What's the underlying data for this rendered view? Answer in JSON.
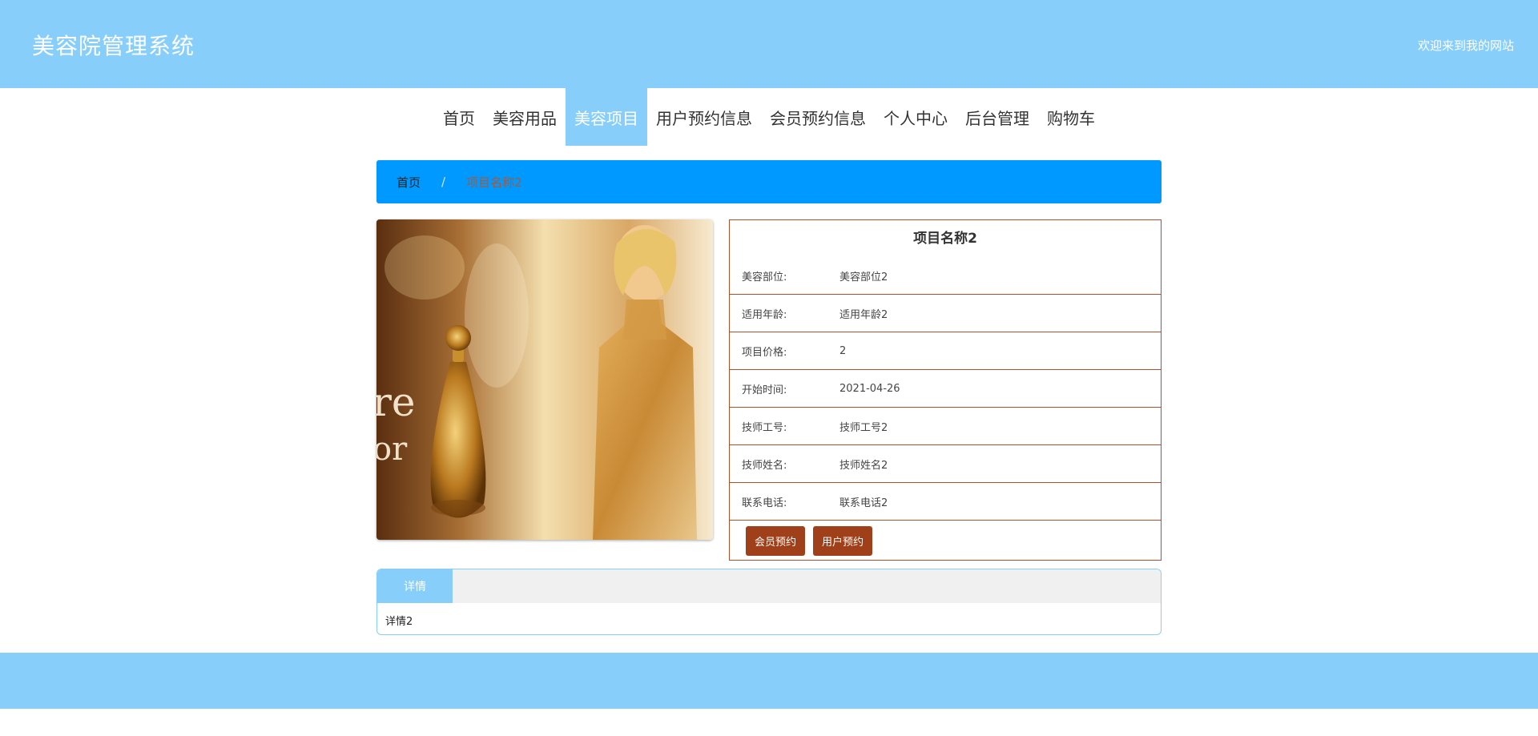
{
  "header": {
    "title": "美容院管理系统",
    "welcome": "欢迎来到我的网站"
  },
  "nav": {
    "items": [
      "首页",
      "美容用品",
      "美容项目",
      "用户预约信息",
      "会员预约信息",
      "个人中心",
      "后台管理",
      "购物车"
    ],
    "active": "美容项目"
  },
  "breadcrumb": {
    "home": "首页",
    "separator": "/",
    "current": "项目名称2"
  },
  "detail": {
    "title": "项目名称2",
    "rows": [
      {
        "label": "美容部位:",
        "value": "美容部位2"
      },
      {
        "label": "适用年龄:",
        "value": "适用年龄2"
      },
      {
        "label": "项目价格:",
        "value": "2"
      },
      {
        "label": "开始时间:",
        "value": "2021-04-26"
      },
      {
        "label": "技师工号:",
        "value": "技师工号2"
      },
      {
        "label": "技师姓名:",
        "value": "技师姓名2"
      },
      {
        "label": "联系电话:",
        "value": "联系电话2"
      }
    ],
    "buttons": {
      "member_booking": "会员预约",
      "user_booking": "用户预约"
    }
  },
  "tabs": {
    "label": "详情",
    "content": "详情2"
  },
  "colors": {
    "header_bg": "#87cefa",
    "breadcrumb_bg": "#0099ff",
    "accent_brown": "#a0401a"
  }
}
